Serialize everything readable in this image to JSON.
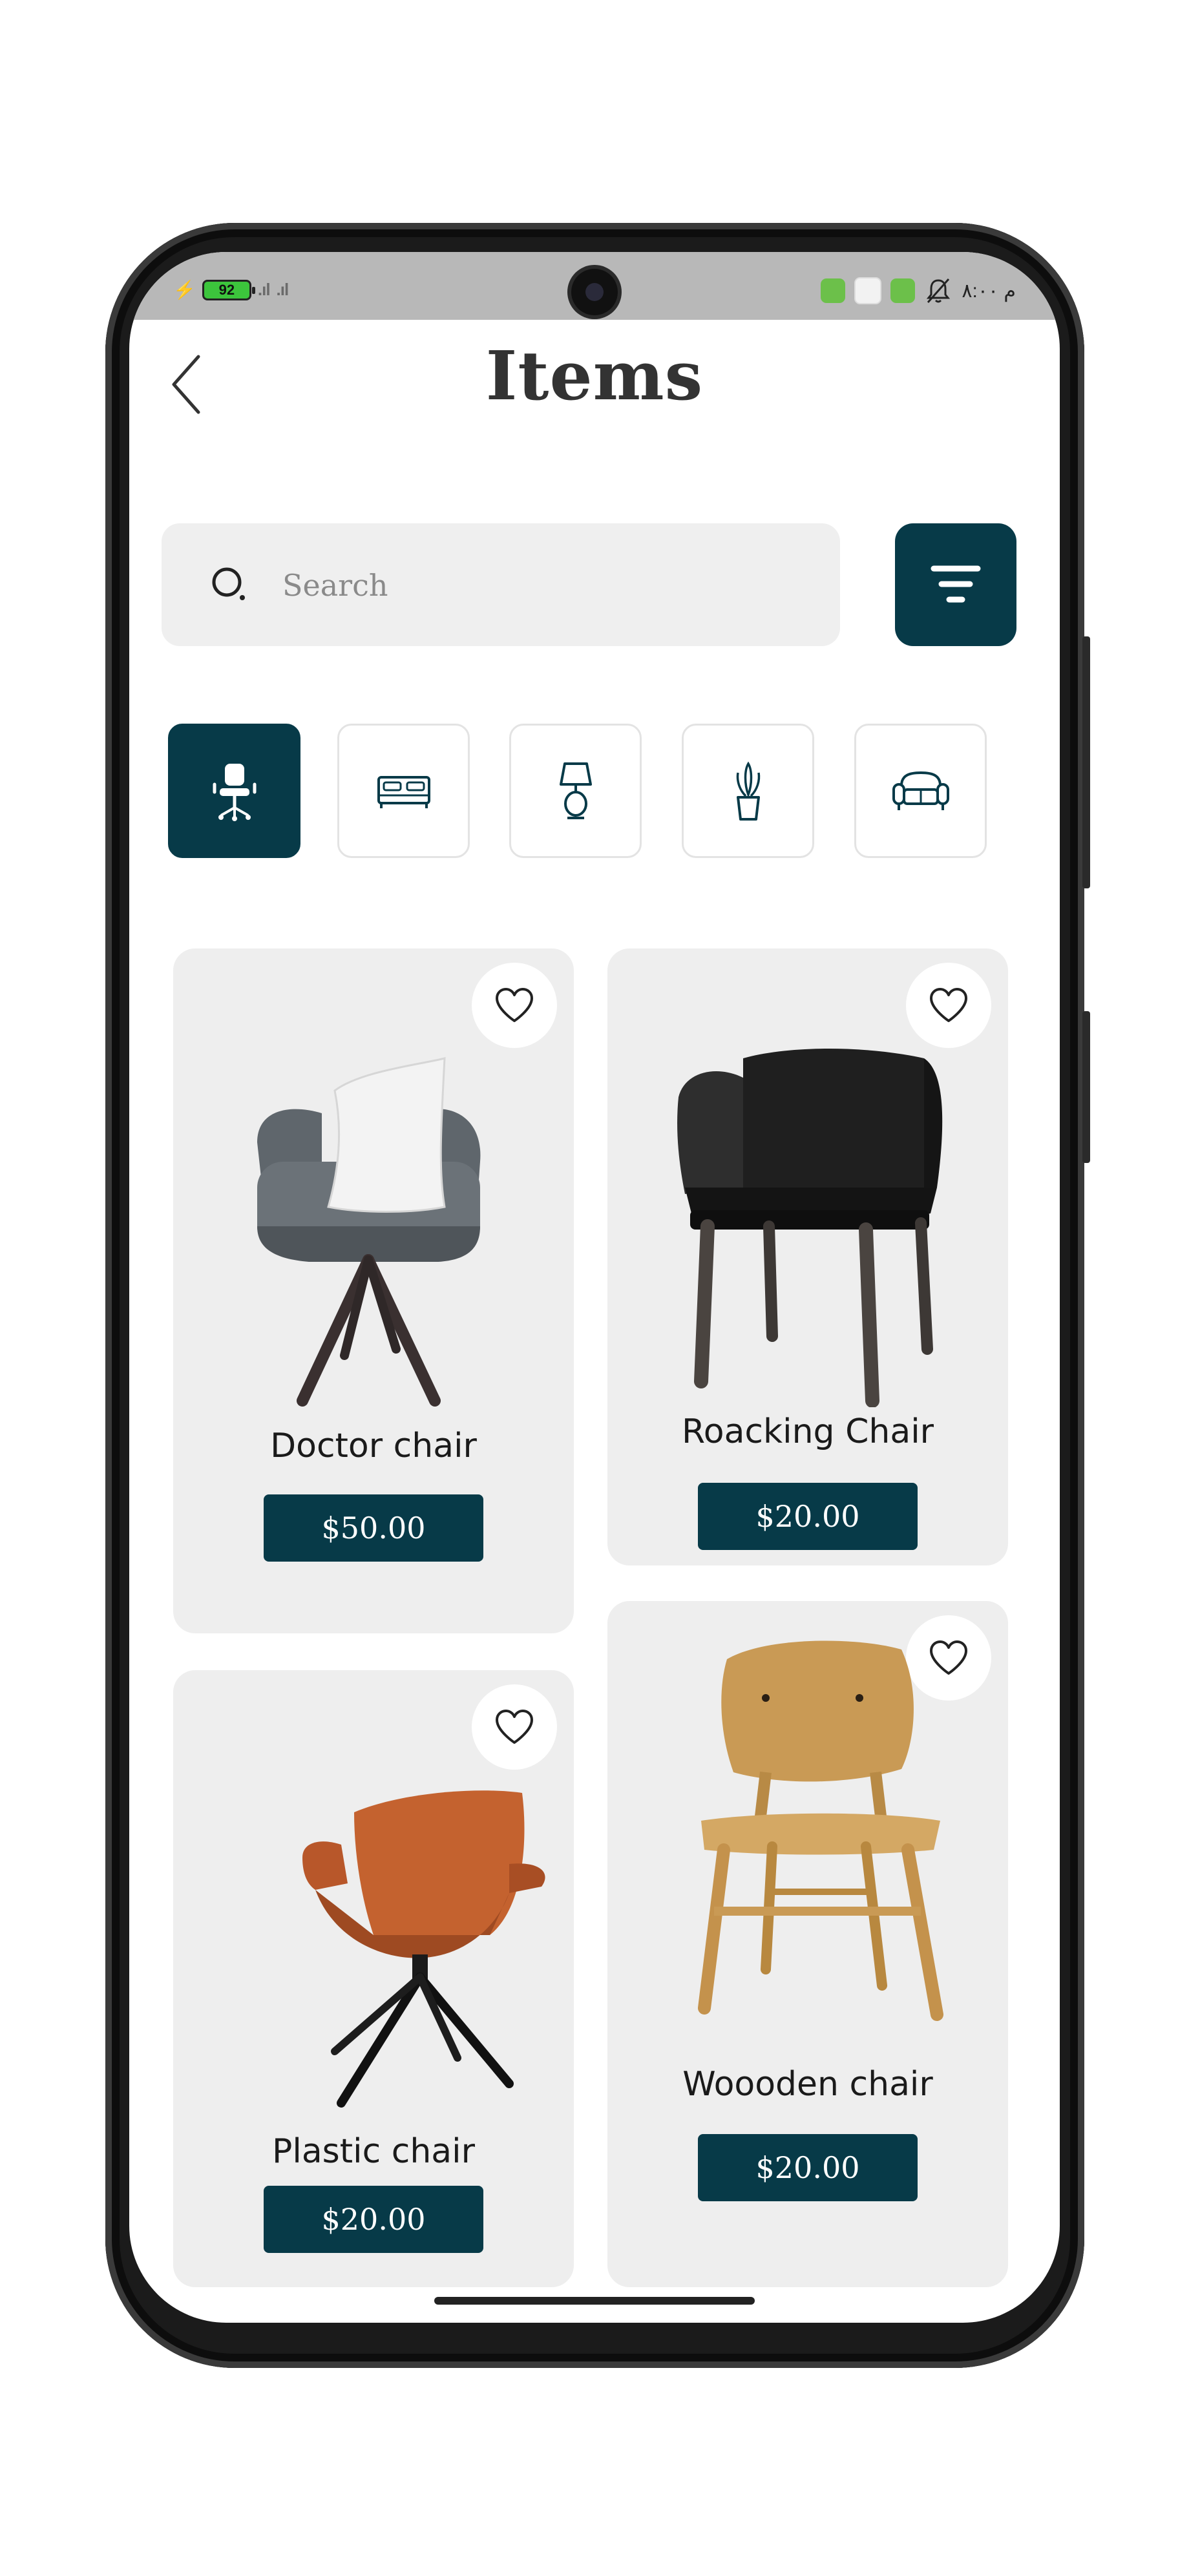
{
  "status_bar": {
    "battery": "92",
    "signal_1": ".ıl",
    "signal_2": ".ıl",
    "time": "م ٨:٠٠"
  },
  "header": {
    "title": "Items",
    "back_icon": "chevron-left-icon"
  },
  "search": {
    "placeholder": "Search",
    "value": ""
  },
  "filter_icon": "filter-lines-icon",
  "categories": [
    {
      "icon": "office-chair-icon",
      "active": true
    },
    {
      "icon": "bed-icon",
      "active": false
    },
    {
      "icon": "lamp-icon",
      "active": false
    },
    {
      "icon": "plant-icon",
      "active": false
    },
    {
      "icon": "sofa-icon",
      "active": false
    }
  ],
  "products": [
    {
      "name": "Doctor chair",
      "price": "$50.00",
      "image": "gray-armchair-with-pillow"
    },
    {
      "name": "Roacking Chair",
      "price": "$20.00",
      "image": "black-leather-chair"
    },
    {
      "name": "Plastic chair",
      "price": "$20.00",
      "image": "orange-leather-chair"
    },
    {
      "name": "Woooden chair",
      "price": "$20.00",
      "image": "wooden-chair"
    }
  ],
  "colors": {
    "primary": "#073a48",
    "card_bg": "#eeeeee",
    "search_bg": "#efefef"
  }
}
